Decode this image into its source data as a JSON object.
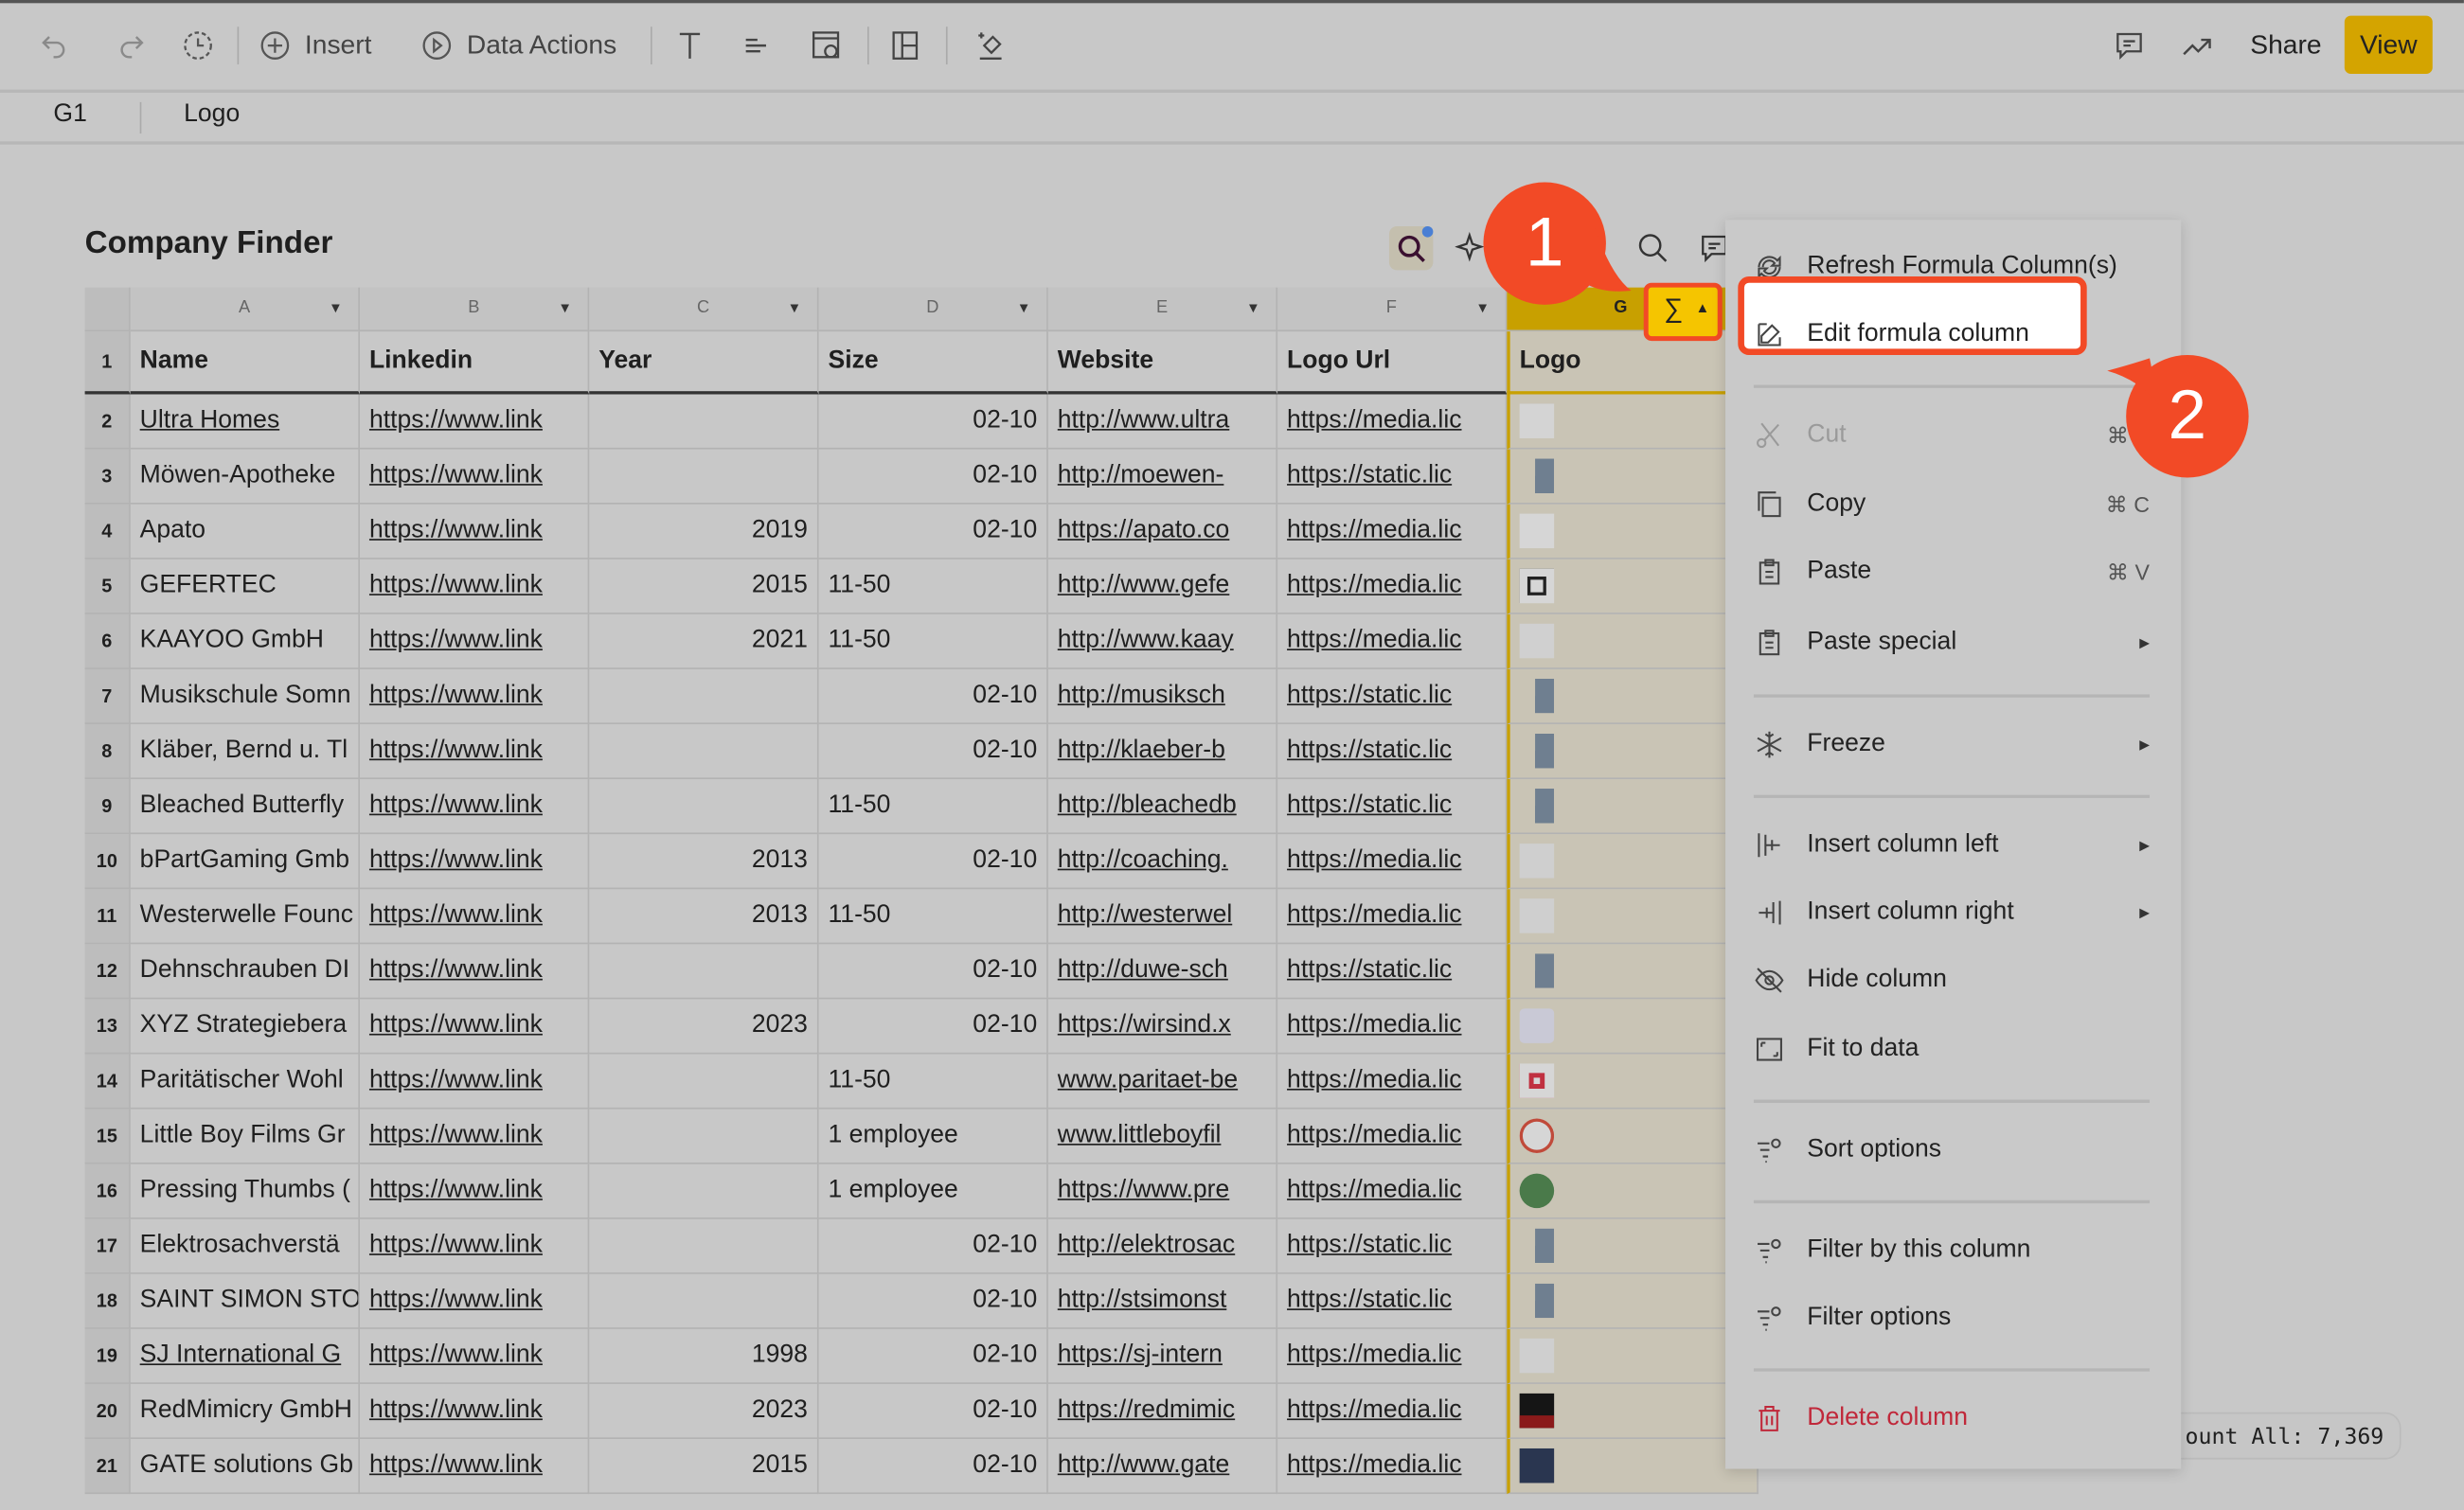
{
  "toolbar": {
    "insert_label": "Insert",
    "data_actions_label": "Data Actions",
    "share_label": "Share",
    "view_label": "View",
    "view_color": "#d4a400"
  },
  "formula_bar": {
    "cell_ref": "G1",
    "value": "Logo"
  },
  "sheet": {
    "title": "Company Finder",
    "column_letters": [
      "A",
      "B",
      "C",
      "D",
      "E",
      "F",
      "G"
    ],
    "headers": [
      "Name",
      "Linkedin",
      "Year",
      "Size",
      "Website",
      "Logo Url",
      "Logo"
    ],
    "rows": [
      {
        "n": "2",
        "name": "Ultra Homes",
        "name_link": true,
        "linkedin": "https://www.link",
        "year": "",
        "size": "02-10",
        "website": "http://www.ultra",
        "logo_url": "https://media.lic",
        "logo": "blank"
      },
      {
        "n": "3",
        "name": "Möwen-Apotheke",
        "linkedin": "https://www.link",
        "year": "",
        "size": "02-10",
        "website": "http://moewen-",
        "logo_url": "https://static.lic",
        "logo": "placeholder"
      },
      {
        "n": "4",
        "name": "Apato",
        "linkedin": "https://www.link",
        "year": "2019",
        "size": "02-10",
        "website": "https://apato.co",
        "logo_url": "https://media.lic",
        "logo": "apato"
      },
      {
        "n": "5",
        "name": "GEFERTEC",
        "linkedin": "https://www.link",
        "year": "2015",
        "size": "11-50",
        "website": "http://www.gefe",
        "logo_url": "https://media.lic",
        "logo": "frame"
      },
      {
        "n": "6",
        "name": "KAAYOO GmbH",
        "linkedin": "https://www.link",
        "year": "2021",
        "size": "11-50",
        "website": "http://www.kaay",
        "logo_url": "https://media.lic",
        "logo": "kaayoo"
      },
      {
        "n": "7",
        "name": "Musikschule Somn",
        "linkedin": "https://www.link",
        "year": "",
        "size": "02-10",
        "website": "http://musiksch",
        "logo_url": "https://static.lic",
        "logo": "placeholder"
      },
      {
        "n": "8",
        "name": "Kläber, Bernd u. Tl",
        "linkedin": "https://www.link",
        "year": "",
        "size": "02-10",
        "website": "http://klaeber-b",
        "logo_url": "https://static.lic",
        "logo": "placeholder"
      },
      {
        "n": "9",
        "name": "Bleached Butterfly",
        "linkedin": "https://www.link",
        "year": "",
        "size": "11-50",
        "website": "http://bleachedb",
        "logo_url": "https://static.lic",
        "logo": "placeholder"
      },
      {
        "n": "10",
        "name": "bPartGaming Gmb",
        "linkedin": "https://www.link",
        "year": "2013",
        "size": "02-10",
        "website": "http://coaching.",
        "logo_url": "https://media.lic",
        "logo": "bpart"
      },
      {
        "n": "11",
        "name": "Westerwelle Founc",
        "linkedin": "https://www.link",
        "year": "2013",
        "size": "11-50",
        "website": "http://westerwel",
        "logo_url": "https://media.lic",
        "logo": "westerwelle"
      },
      {
        "n": "12",
        "name": "Dehnschrauben DI",
        "linkedin": "https://www.link",
        "year": "",
        "size": "02-10",
        "website": "http://duwe-sch",
        "logo_url": "https://static.lic",
        "logo": "placeholder"
      },
      {
        "n": "13",
        "name": "XYZ Strategiebera",
        "linkedin": "https://www.link",
        "year": "2023",
        "size": "02-10",
        "website": "https://wirsind.x",
        "logo_url": "https://media.lic",
        "logo": "cube"
      },
      {
        "n": "14",
        "name": "Paritätischer Wohl",
        "linkedin": "https://www.link",
        "year": "",
        "size": "11-50",
        "website": "www.paritaet-be",
        "logo_url": "https://media.lic",
        "logo": "paritaet"
      },
      {
        "n": "15",
        "name": "Little Boy Films Gr",
        "linkedin": "https://www.link",
        "year": "",
        "size": "1 employee",
        "website": "www.littleboyfil",
        "logo_url": "https://media.lic",
        "logo": "littleboy"
      },
      {
        "n": "16",
        "name": "Pressing Thumbs (",
        "linkedin": "https://www.link",
        "year": "",
        "size": "1 employee",
        "website": "https://www.pre",
        "logo_url": "https://media.lic",
        "logo": "pressing"
      },
      {
        "n": "17",
        "name": "Elektrosachverstä",
        "linkedin": "https://www.link",
        "year": "",
        "size": "02-10",
        "website": "http://elektrosac",
        "logo_url": "https://static.lic",
        "logo": "placeholder"
      },
      {
        "n": "18",
        "name": "SAINT SIMON STO",
        "linkedin": "https://www.link",
        "year": "",
        "size": "02-10",
        "website": "http://stsimonst",
        "logo_url": "https://static.lic",
        "logo": "placeholder"
      },
      {
        "n": "19",
        "name": "SJ International G",
        "name_link": true,
        "linkedin": "https://www.link",
        "year": "1998",
        "size": "02-10",
        "website": "https://sj-intern",
        "logo_url": "https://media.lic",
        "logo": "sj"
      },
      {
        "n": "20",
        "name": "RedMimicry GmbH",
        "linkedin": "https://www.link",
        "year": "2023",
        "size": "02-10",
        "website": "https://redmimic",
        "logo_url": "https://media.lic",
        "logo": "redmimicry"
      },
      {
        "n": "21",
        "name": "GATE solutions Gb",
        "linkedin": "https://www.link",
        "year": "2015",
        "size": "02-10",
        "website": "http://www.gate",
        "logo_url": "https://media.lic",
        "logo": "gate"
      }
    ]
  },
  "context_menu": {
    "items": [
      {
        "label": "Refresh Formula Column(s)",
        "icon": "refresh-icon"
      },
      {
        "label": "Edit formula column",
        "icon": "edit-icon",
        "highlighted": true
      },
      {
        "label": "Cut",
        "icon": "scissors-icon",
        "shortcut": "⌘ X",
        "disabled": true
      },
      {
        "label": "Copy",
        "icon": "copy-icon",
        "shortcut": "⌘ C"
      },
      {
        "label": "Paste",
        "icon": "clipboard-icon",
        "shortcut": "⌘ V"
      },
      {
        "label": "Paste special",
        "icon": "clipboard-icon",
        "submenu": true
      },
      {
        "label": "Freeze",
        "icon": "snowflake-icon",
        "submenu": true
      },
      {
        "label": "Insert column left",
        "icon": "insert-column-left-icon",
        "submenu": true
      },
      {
        "label": "Insert column right",
        "icon": "insert-column-right-icon",
        "submenu": true
      },
      {
        "label": "Hide column",
        "icon": "eye-off-icon"
      },
      {
        "label": "Fit to data",
        "icon": "fit-icon"
      },
      {
        "label": "Sort options",
        "icon": "sort-settings-icon"
      },
      {
        "label": "Filter by this column",
        "icon": "filter-settings-icon"
      },
      {
        "label": "Filter options",
        "icon": "filter-settings-icon"
      },
      {
        "label": "Delete column",
        "icon": "trash-icon",
        "danger": true
      }
    ],
    "danger_color": "#c0283a"
  },
  "callouts": [
    {
      "label": "1"
    },
    {
      "label": "2"
    }
  ],
  "callout_color": "#f24a26",
  "status": {
    "count_all": "ount All: 7,369"
  }
}
